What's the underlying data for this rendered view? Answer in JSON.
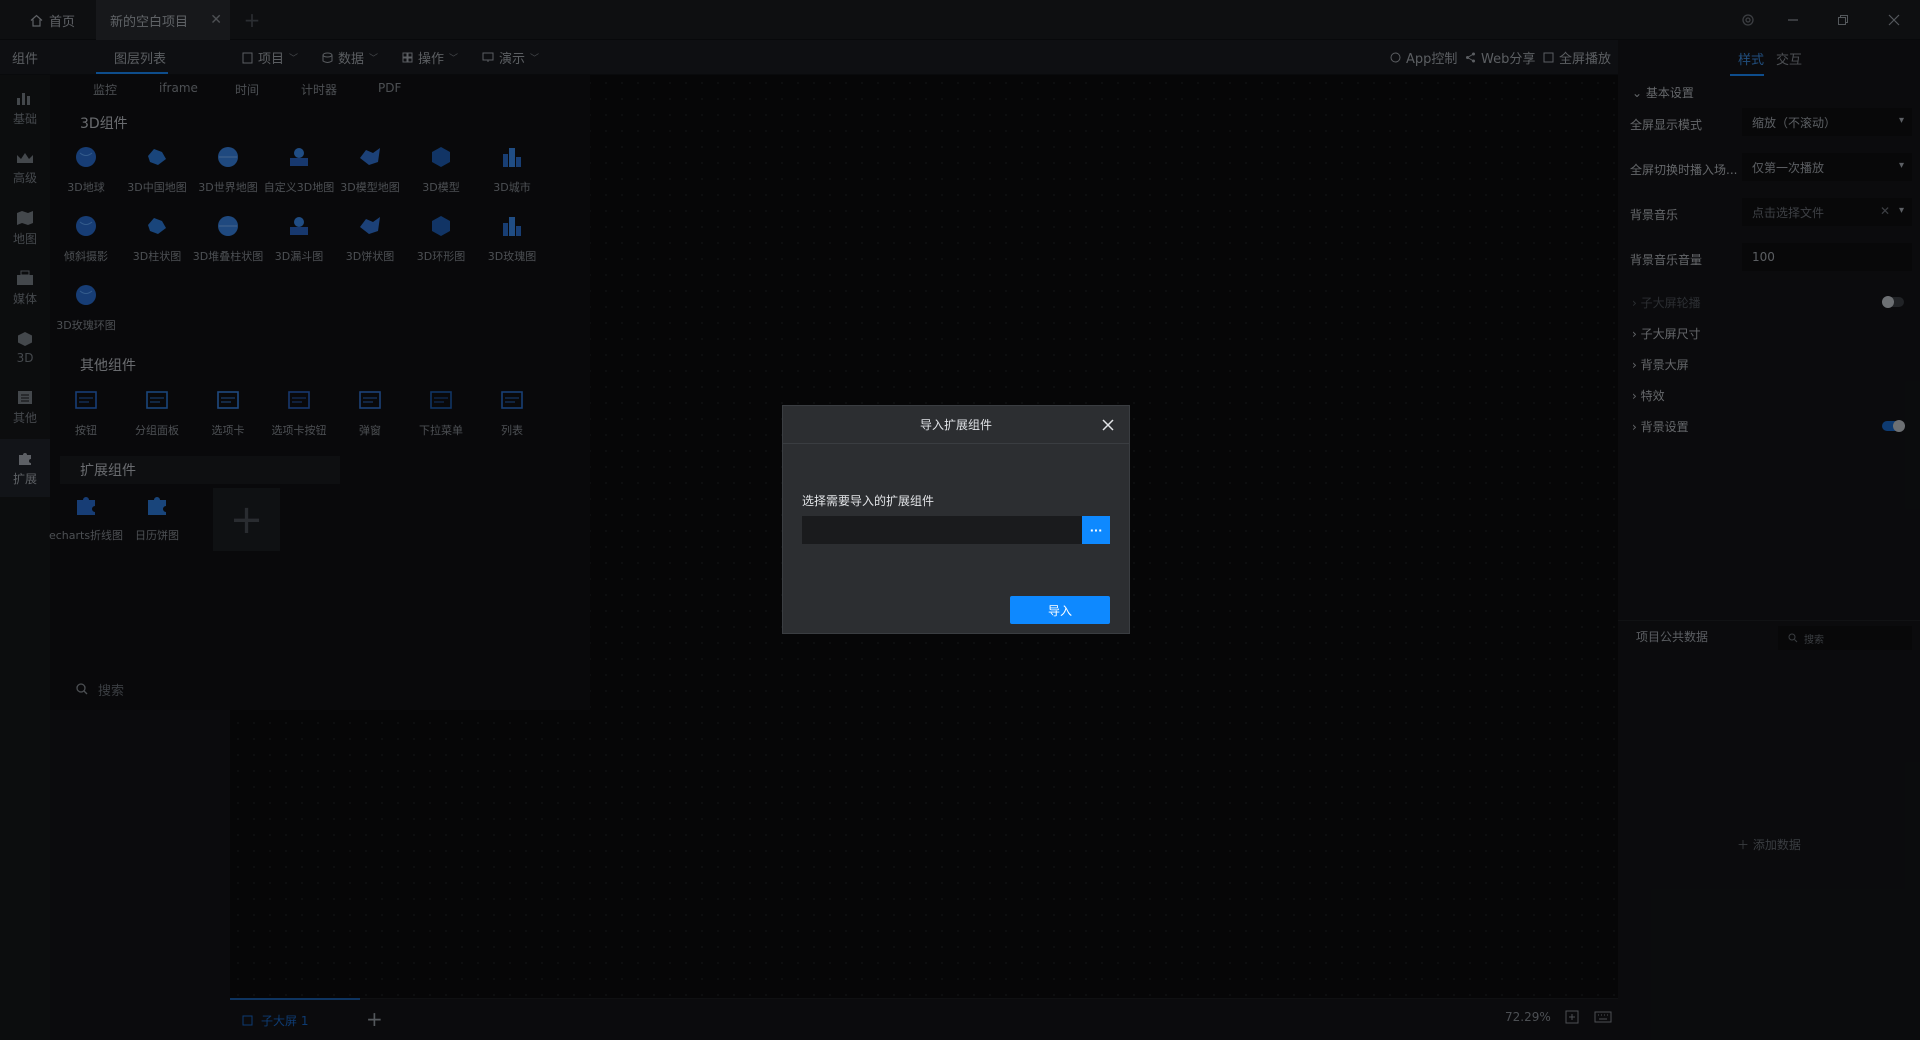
{
  "titlebar": {
    "home_tab": "首页",
    "project_tab": "新的空白项目",
    "add_tab": "+"
  },
  "toolbar": {
    "components_label": "组件",
    "layers_tab": "图层列表",
    "menus": [
      "项目",
      "数据",
      "操作",
      "演示"
    ],
    "app_control": "App控制",
    "web_share": "Web分享",
    "fullscreen": "全屏播放"
  },
  "leftnav": [
    {
      "label": "基础",
      "icon": "bar-chart-icon"
    },
    {
      "label": "高级",
      "icon": "crown-icon"
    },
    {
      "label": "地图",
      "icon": "map-icon"
    },
    {
      "label": "媒体",
      "icon": "media-icon"
    },
    {
      "label": "3D",
      "icon": "cube-icon"
    },
    {
      "label": "其他",
      "icon": "list-icon"
    },
    {
      "label": "扩展",
      "icon": "puzzle-icon"
    }
  ],
  "comp_subtabs": [
    "监控",
    "iframe",
    "时间",
    "计时器",
    "PDF"
  ],
  "sections": {
    "three_d": "3D组件",
    "other": "其他组件",
    "ext": "扩展组件"
  },
  "comps_3d": [
    "3D地球",
    "3D中国地图",
    "3D世界地图",
    "自定义3D地图",
    "3D模型地图",
    "3D模型",
    "3D城市",
    "倾斜摄影",
    "3D柱状图",
    "3D堆叠柱状图",
    "3D漏斗图",
    "3D饼状图",
    "3D环形图",
    "3D玫瑰图",
    "3D玫瑰环图"
  ],
  "comps_other": [
    "按钮",
    "分组面板",
    "选项卡",
    "选项卡按钮",
    "弹窗",
    "下拉菜单",
    "列表"
  ],
  "comps_ext": [
    "echarts折线图",
    "日历饼图"
  ],
  "comp_search_placeholder": "搜索",
  "bottom": {
    "screen_tab": "子大屏 1",
    "zoom": "72.29%"
  },
  "rightpanel": {
    "tab_style": "样式",
    "tab_interact": "交互",
    "basic_settings": "基本设置",
    "fullscreen_mode_label": "全屏显示模式",
    "fullscreen_mode_value": "缩放（不滚动）",
    "switch_label": "全屏切换时播入场...",
    "switch_value": "仅第一次播放",
    "bgmusic_label": "背景音乐",
    "bgmusic_value": "点击选择文件",
    "bgvolume_label": "背景音乐音量",
    "bgvolume_value": "100",
    "groups": [
      "子大屏轮播",
      "子大屏尺寸",
      "背景大屏",
      "特效",
      "背景设置"
    ],
    "public_data": "项目公共数据",
    "data_search_placeholder": "搜索",
    "add_data": "添加数据"
  },
  "toggles": {
    "carousel_on": false,
    "bg_settings_on": true
  },
  "modal": {
    "title": "导入扩展组件",
    "label": "选择需要导入的扩展组件",
    "file_value": "",
    "browse": "···",
    "import": "导入"
  },
  "colors": {
    "accent": "#0e89ff",
    "modal_bg": "#2c2e31"
  }
}
